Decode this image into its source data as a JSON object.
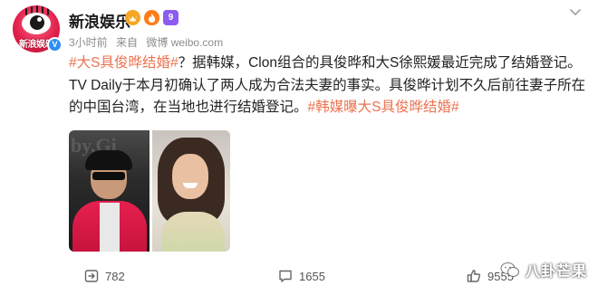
{
  "account": {
    "name": "新浪娱乐",
    "avatar_brand": "新浪娱乐",
    "verified_icon": "verified-v-icon",
    "badges": [
      "vip-icon",
      "fire-icon",
      "level-badge-icon"
    ],
    "level_label": "9"
  },
  "meta": {
    "time": "3小时前",
    "source_prefix": "来自",
    "source": "微博 weibo.com"
  },
  "post": {
    "hashtag1": "#大S具俊晔结婚#",
    "body": "？据韩媒，Clon组合的具俊晔和大S徐熙媛最近完成了结婚登记。TV Daily于本月初确认了两人成为合法夫妻的事实。具俊晔计划不久后前往妻子所在的中国台湾，在当地也进行结婚登记。",
    "hashtag2": "#韩媒曝大S具俊晔结婚#"
  },
  "photos": {
    "left_bg_text": "by.Gi",
    "images": [
      "man-photo",
      "woman-photo"
    ]
  },
  "actions": {
    "repost_count": "782",
    "comment_count": "1655",
    "like_count": "9555"
  },
  "watermark": {
    "text": "八卦芒果"
  },
  "colors": {
    "hashtag": "#eb7350",
    "brand_red": "#e3224d",
    "verified_blue": "#2d8cf0"
  }
}
